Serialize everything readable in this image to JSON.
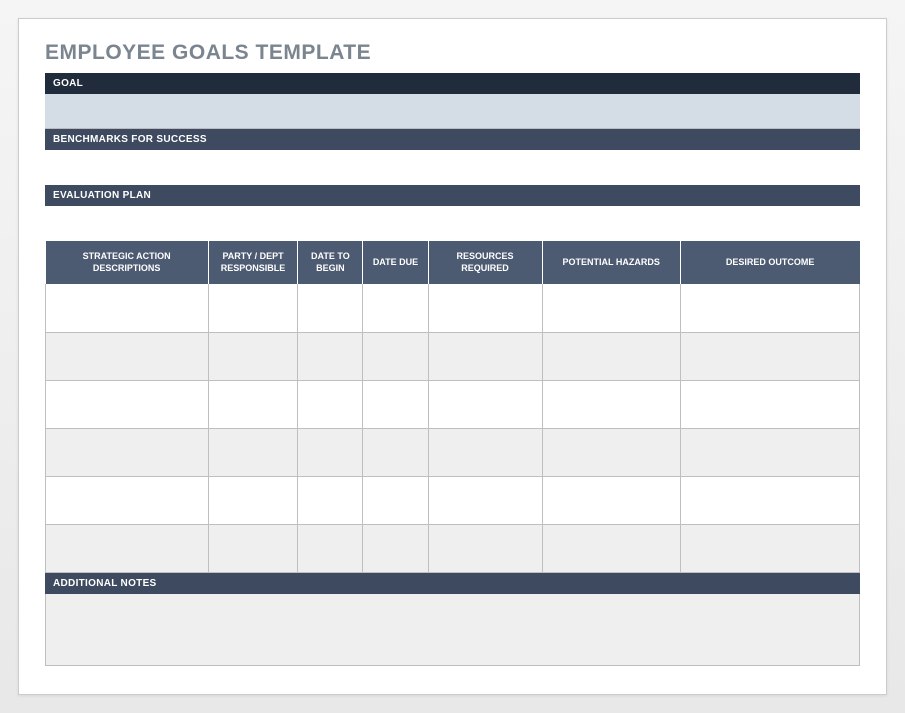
{
  "title": "EMPLOYEE GOALS TEMPLATE",
  "sections": {
    "goal": {
      "header": "GOAL",
      "value": ""
    },
    "benchmarks": {
      "header": "BENCHMARKS FOR SUCCESS",
      "value": ""
    },
    "evaluation": {
      "header": "EVALUATION PLAN",
      "value": ""
    },
    "notes": {
      "header": "ADDITIONAL NOTES",
      "value": ""
    }
  },
  "table": {
    "columns": [
      "STRATEGIC ACTION DESCRIPTIONS",
      "PARTY / DEPT RESPONSIBLE",
      "DATE TO BEGIN",
      "DATE DUE",
      "RESOURCES REQUIRED",
      "POTENTIAL HAZARDS",
      "DESIRED OUTCOME"
    ],
    "rows": [
      [
        "",
        "",
        "",
        "",
        "",
        "",
        ""
      ],
      [
        "",
        "",
        "",
        "",
        "",
        "",
        ""
      ],
      [
        "",
        "",
        "",
        "",
        "",
        "",
        ""
      ],
      [
        "",
        "",
        "",
        "",
        "",
        "",
        ""
      ],
      [
        "",
        "",
        "",
        "",
        "",
        "",
        ""
      ],
      [
        "",
        "",
        "",
        "",
        "",
        "",
        ""
      ]
    ]
  }
}
